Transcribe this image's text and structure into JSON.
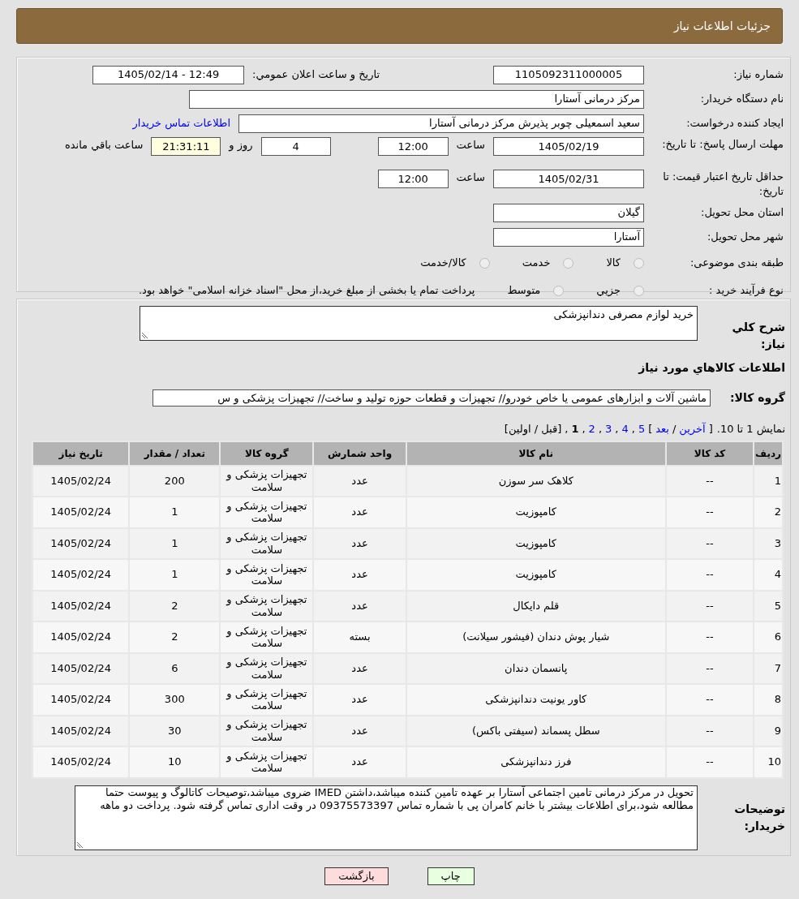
{
  "header": {
    "title": "جزئیات اطلاعات نیاز"
  },
  "need_number": {
    "label": "شماره نیاز:",
    "value": "1105092311000005"
  },
  "announce": {
    "label": "تاریخ و ساعت اعلان عمومي:",
    "value": "1405/02/14 - 12:49"
  },
  "buyer_org": {
    "label": "نام دستگاه خریدار:",
    "value": "مرکز درمانی آستارا"
  },
  "requester": {
    "label": "ایجاد کننده درخواست:",
    "value": "سعید اسمعیلی چوبر پذیرش مرکز درمانی آستارا",
    "link": "اطلاعات تماس خریدار"
  },
  "deadline": {
    "label": "مهلت ارسال پاسخ: تا تاریخ:",
    "date": "1405/02/19",
    "time_label": "ساعت",
    "time": "12:00",
    "days": "4",
    "days_label": "روز و",
    "remaining": "21:31:11",
    "remaining_label": "ساعت باقي مانده"
  },
  "validity": {
    "label": "حداقل تاریخ اعتبار قیمت: تا تاریخ:",
    "date": "1405/02/31",
    "time_label": "ساعت",
    "time": "12:00"
  },
  "province": {
    "label": "استان محل تحویل:",
    "value": "گیلان"
  },
  "city": {
    "label": "شهر محل تحویل:",
    "value": "آستارا"
  },
  "category": {
    "label": "طبقه بندی موضوعی:",
    "options": [
      {
        "label": "کالا",
        "selected": false
      },
      {
        "label": "خدمت",
        "selected": false
      },
      {
        "label": "کالا/خدمت",
        "selected": false
      }
    ]
  },
  "process": {
    "label": "نوع فرآیند خرید :",
    "options": [
      {
        "label": "جزيي",
        "selected": false
      },
      {
        "label": "متوسط",
        "selected": false
      }
    ],
    "note": "پرداخت تمام یا بخشی از مبلغ خرید،از محل \"اسناد خزانه اسلامی\" خواهد بود."
  },
  "summary": {
    "label": "شرح کلي نیاز:",
    "value": "خرید لوازم مصرفی دندانپزشکی"
  },
  "goods_title": "اطلاعات کالاهاي مورد نیاز",
  "goods_group": {
    "label": "گروه کالا:",
    "value": "ماشین آلات و ابزارهای عمومی یا خاص خودرو// تجهیزات و قطعات حوزه تولید و ساخت// تجهیزات پزشکی و س"
  },
  "pager": {
    "info": "نمایش 1 تا 10.",
    "items": [
      {
        "label": "[",
        "kind": "text"
      },
      {
        "label": "آخرین",
        "kind": "link"
      },
      {
        "label": "/",
        "kind": "text"
      },
      {
        "label": "بعد",
        "kind": "link"
      },
      {
        "label": "]",
        "kind": "text"
      },
      {
        "label": "5",
        "kind": "link"
      },
      {
        "label": ",",
        "kind": "text"
      },
      {
        "label": "4",
        "kind": "link"
      },
      {
        "label": ",",
        "kind": "text"
      },
      {
        "label": "3",
        "kind": "link"
      },
      {
        "label": ",",
        "kind": "text"
      },
      {
        "label": "2",
        "kind": "link"
      },
      {
        "label": ",",
        "kind": "text"
      },
      {
        "label": "1",
        "kind": "current"
      },
      {
        "label": ",",
        "kind": "text"
      },
      {
        "label": "[قبل / اولین]",
        "kind": "text"
      }
    ]
  },
  "table": {
    "columns": [
      "ردیف",
      "کد کالا",
      "نام کالا",
      "واحد شمارش",
      "گروه کالا",
      "تعداد / مقدار",
      "تاریخ نیاز"
    ],
    "rows": [
      [
        "1",
        "--",
        "کلاهک سر سوزن",
        "عدد",
        "تجهیزات پزشکی و سلامت",
        "200",
        "1405/02/24"
      ],
      [
        "2",
        "--",
        "کامپوزیت",
        "عدد",
        "تجهیزات پزشکی و سلامت",
        "1",
        "1405/02/24"
      ],
      [
        "3",
        "--",
        "کامپوزیت",
        "عدد",
        "تجهیزات پزشکی و سلامت",
        "1",
        "1405/02/24"
      ],
      [
        "4",
        "--",
        "کامپوزیت",
        "عدد",
        "تجهیزات پزشکی و سلامت",
        "1",
        "1405/02/24"
      ],
      [
        "5",
        "--",
        "قلم دایکال",
        "عدد",
        "تجهیزات پزشکی و سلامت",
        "2",
        "1405/02/24"
      ],
      [
        "6",
        "--",
        "شیار پوش دندان (فیشور سیلانت)",
        "بسته",
        "تجهیزات پزشکی و سلامت",
        "2",
        "1405/02/24"
      ],
      [
        "7",
        "--",
        "پانسمان دندان",
        "عدد",
        "تجهیزات پزشکی و سلامت",
        "6",
        "1405/02/24"
      ],
      [
        "8",
        "--",
        "کاور یونیت دندانپزشکی",
        "عدد",
        "تجهیزات پزشکی و سلامت",
        "300",
        "1405/02/24"
      ],
      [
        "9",
        "--",
        "سطل پسماند (سیفتی باکس)",
        "عدد",
        "تجهیزات پزشکی و سلامت",
        "30",
        "1405/02/24"
      ],
      [
        "10",
        "--",
        "فرز دندانپزشکی",
        "عدد",
        "تجهیزات پزشکی و سلامت",
        "10",
        "1405/02/24"
      ]
    ]
  },
  "buyer_notes": {
    "label": "توضیحات خریدار:",
    "value": "تحویل در مرکز درمانی تامین اجتماعی آستارا بر عهده تامین کننده میباشد،داشتن IMED ضروی میباشد،توصیحات کاتالوگ و پیوست حتما مطالعه شود،برای اطلاعات بیشتر با خانم کامران پی با شماره تماس 09375573397 در وقت اداری تماس گرفته شود. پرداخت دو ماهه"
  },
  "buttons": [
    {
      "label": "چاپ",
      "kind": "print"
    },
    {
      "label": "بازگشت",
      "kind": "back"
    }
  ]
}
